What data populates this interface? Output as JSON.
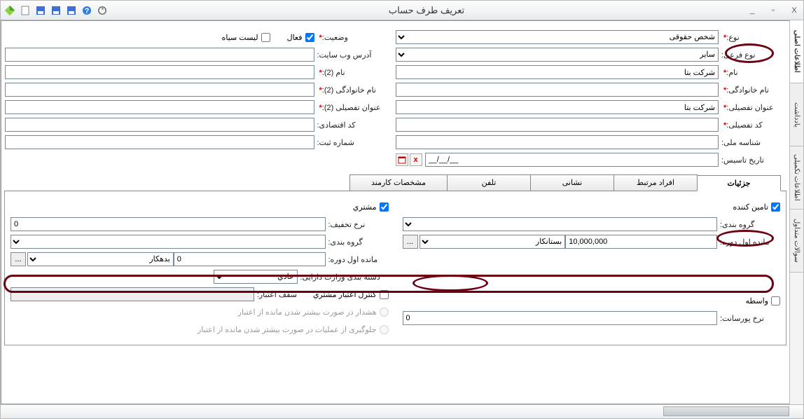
{
  "window": {
    "title": "تعریف طرف حساب",
    "close_glyph": "X",
    "min_glyph": "_"
  },
  "vtabs": [
    "اطلاعات اصلی",
    "یادداشت",
    "اطلاعات تکمیلی",
    "سوالات متداول"
  ],
  "labels": {
    "type": "نوع:",
    "subtype": "نوع فرعی:",
    "name": "نام:",
    "family": "نام خانوادگی:",
    "detailtitle": "عنوان تفصیلی:",
    "detailcode": "کد تفصیلی:",
    "nationalid": "شناسه ملی:",
    "founddate": "تاریخ تاسیس:",
    "status": "وضعیت:",
    "website": "آدرس وب سایت:",
    "name2": "نام (2):",
    "family2": "نام خانوادگی (2):",
    "detailtitle2": "عنوان تفصیلی (2):",
    "economic": "کد اقتصادی:",
    "regno": "شماره ثبت:",
    "active": "فعال",
    "blacklist": "لیست سیاه"
  },
  "values": {
    "type": "شخص حقوقی",
    "subtype": "سایر",
    "name": "شرکت بتا",
    "family": "",
    "detailtitle": "شرکت بتا",
    "detailcode": "",
    "nationalid": "",
    "founddate": "__/__/__",
    "status": "",
    "website": "",
    "name2": "",
    "family2": "",
    "detailtitle2": "",
    "economic": "",
    "regno": ""
  },
  "subtabs": [
    "جزئیات",
    "افراد مرتبط",
    "نشانی",
    "تلفن",
    "مشخصات کارمند"
  ],
  "details_labels": {
    "supplier": "تامین کننده",
    "group": "گروه بندی:",
    "opening": "مانده اول دوره:",
    "creditor": "بستانکار",
    "customer": "مشتري",
    "discountrate": "نرخ تخفیف:",
    "group2": "گروه بندی:",
    "opening2": "مانده اول دوره:",
    "debtor": "بدهکار",
    "taxcat": "دسته بندی وزارت دارایی:",
    "normal": "عادي",
    "creditctrl": "کنترل اعتبار مشتري",
    "ceiling": "سقف اعتبار:",
    "warn": "هشدار در صورت بیشتر شدن مانده از اعتبار",
    "block": "جلوگیری از عملیات در صورت بیشتر شدن مانده از اعتبار",
    "agent": "واسطه",
    "commission": "نرخ پورسانت:"
  },
  "details_values": {
    "opening": "10,000,000",
    "discountrate": "0",
    "opening2": "0",
    "commission": "0"
  }
}
